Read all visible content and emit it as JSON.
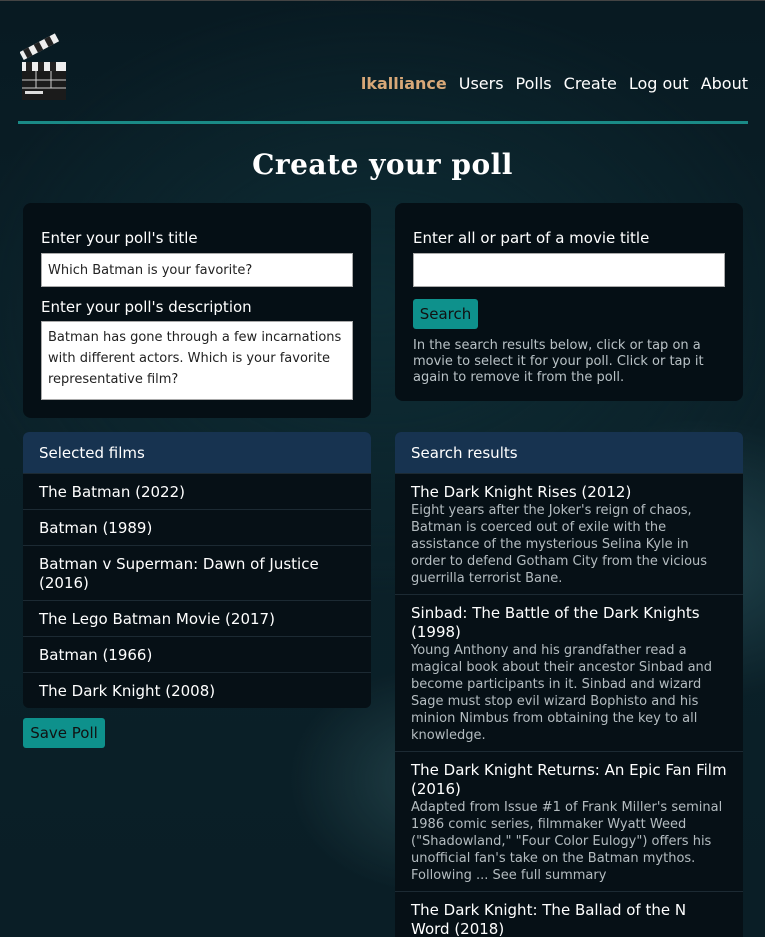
{
  "nav": {
    "items": [
      "lkalliance",
      "Users",
      "Polls",
      "Create",
      "Log out",
      "About"
    ]
  },
  "page": {
    "title": "Create your poll"
  },
  "poll_form": {
    "title_label": "Enter your poll's title",
    "title_value": "Which Batman is your favorite?",
    "description_label": "Enter your poll's description",
    "description_value": "Batman has gone through a few incarnations with different actors. Which is your favorite representative film?"
  },
  "search_form": {
    "label": "Enter all or part of a movie title",
    "value": "",
    "button": "Search",
    "help": "In the search results below, click or tap on a movie to select it for your poll. Click or tap it again to remove it from the poll."
  },
  "selected": {
    "header": "Selected films",
    "items": [
      "The Batman (2022)",
      "Batman (1989)",
      "Batman v Superman: Dawn of Justice (2016)",
      "The Lego Batman Movie (2017)",
      "Batman (1966)",
      "The Dark Knight (2008)"
    ],
    "save_button": "Save Poll"
  },
  "results": {
    "header": "Search results",
    "items": [
      {
        "title": "The Dark Knight Rises (2012)",
        "desc": "Eight years after the Joker's reign of chaos, Batman is coerced out of exile with the assistance of the mysterious Selina Kyle in order to defend Gotham City from the vicious guerrilla terrorist Bane."
      },
      {
        "title": "Sinbad: The Battle of the Dark Knights (1998)",
        "desc": "Young Anthony and his grandfather read a magical book about their ancestor Sinbad and become participants in it. Sinbad and wizard Sage must stop evil wizard Bophisto and his minion Nimbus from obtaining the key to all knowledge."
      },
      {
        "title": "The Dark Knight Returns: An Epic Fan Film (2016)",
        "desc": "Adapted from Issue #1 of Frank Miller's seminal 1986 comic series, filmmaker Wyatt Weed (\"Shadowland,\" \"Four Color Eulogy\") offers his unofficial fan's take on the Batman mythos. Following ... See full summary"
      },
      {
        "title": "The Dark Knight: The Ballad of the N Word (2018)",
        "desc": ""
      }
    ]
  },
  "colors": {
    "accent": "#0e918c",
    "nav_active": "#d8a878",
    "card_header": "#173350"
  }
}
